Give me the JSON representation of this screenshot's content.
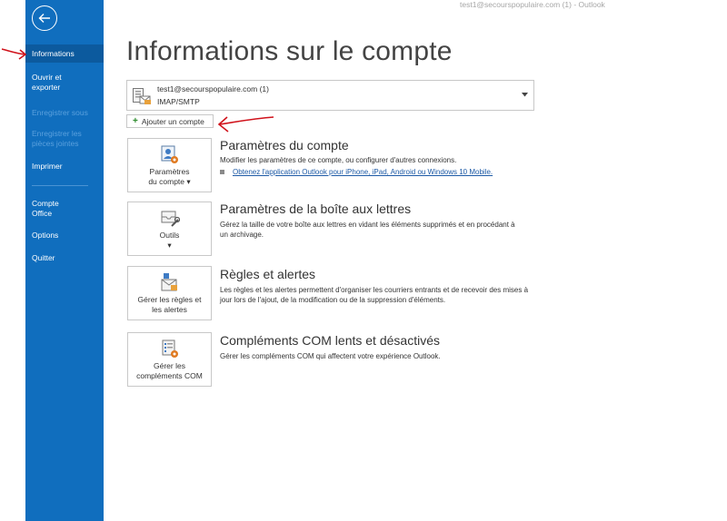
{
  "window": {
    "title": "test1@secourspopulaire.com (1)  -  Outlook"
  },
  "sidebar": {
    "items": [
      {
        "label": "Informations"
      },
      {
        "label": "Ouvrir et exporter"
      },
      {
        "label": "Enregistrer sous"
      },
      {
        "label": "Enregistrer les pièces jointes"
      },
      {
        "label": "Imprimer"
      },
      {
        "label": "Compte Office"
      },
      {
        "label": "Options"
      },
      {
        "label": "Quitter"
      }
    ]
  },
  "page": {
    "title": "Informations sur le compte"
  },
  "account": {
    "email": "test1@secourspopulaire.com (1)",
    "type": "IMAP/SMTP"
  },
  "add_account": {
    "label": "Ajouter un compte"
  },
  "sections": [
    {
      "tile_label_1": "Paramètres",
      "tile_label_2": "du compte ▾",
      "title": "Paramètres du compte",
      "desc": "Modifier les paramètres de ce compte, ou configurer d'autres connexions.",
      "link": "Obtenez l'application Outlook pour iPhone, iPad, Android ou Windows 10 Mobile."
    },
    {
      "tile_label_1": "Outils",
      "tile_label_2": "▾",
      "title": "Paramètres de la boîte aux lettres",
      "desc": "Gérez la taille de votre boîte aux lettres en vidant les éléments supprimés et en procédant à un archivage."
    },
    {
      "tile_label_1": "Gérer les règles et",
      "tile_label_2": "les alertes",
      "title": "Règles et alertes",
      "desc": "Les règles et les alertes permettent d'organiser les courriers entrants et de recevoir des mises à jour lors de l'ajout, de la modification ou de la suppression d'éléments."
    },
    {
      "tile_label_1": "Gérer les",
      "tile_label_2": "compléments COM",
      "title": "Compléments COM lents et désactivés",
      "desc": "Gérer les compléments COM qui affectent votre expérience Outlook."
    }
  ],
  "colors": {
    "sidebar": "#106ebe",
    "sidebar_active": "#0c5a9e",
    "annotation": "#d0121b",
    "link": "#1d5aa6"
  }
}
